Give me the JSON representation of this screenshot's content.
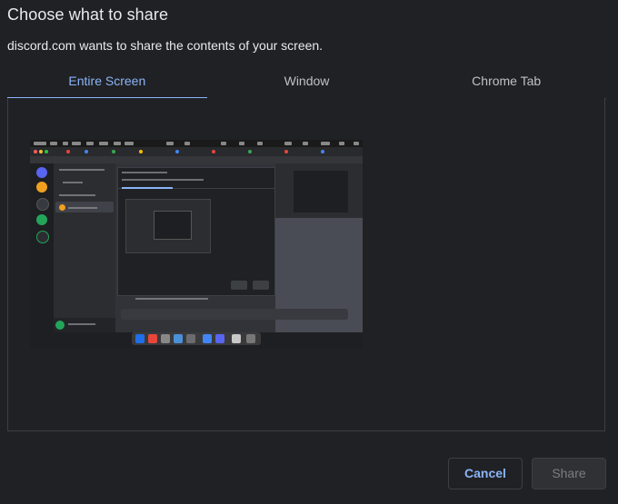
{
  "dialog": {
    "title": "Choose what to share",
    "subtitle": "discord.com wants to share the contents of your screen."
  },
  "tabs": [
    {
      "label": "Entire Screen",
      "active": true
    },
    {
      "label": "Window",
      "active": false
    },
    {
      "label": "Chrome Tab",
      "active": false
    }
  ],
  "actions": {
    "cancel_label": "Cancel",
    "share_label": "Share",
    "share_enabled": false
  },
  "colors": {
    "accent": "#8ab4f8",
    "background": "#202124",
    "border": "#3c4043",
    "text": "#e8eaed"
  },
  "preview": {
    "type": "entire-screen-thumbnail",
    "icons": [
      "discord-icon",
      "chrome-icon",
      "dock-icon"
    ]
  }
}
